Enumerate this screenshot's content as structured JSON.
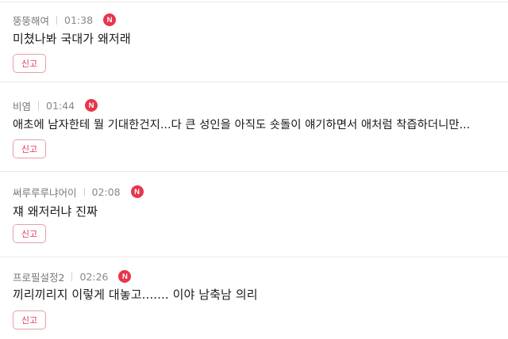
{
  "comments": [
    {
      "author": "뚱뚱해여",
      "time": "01:38",
      "badge": "N",
      "text": "미쳤나봐 국대가 왜저래",
      "report_label": "신고"
    },
    {
      "author": "비염",
      "time": "01:44",
      "badge": "N",
      "text": "애초에 남자한테 뭘 기대한건지...다 큰 성인을 아직도 숏돌이 얘기하면서 애처럼 착즙하더니만...",
      "report_label": "신고"
    },
    {
      "author": "써루루루냐어이",
      "time": "02:08",
      "badge": "N",
      "text": "쟤 왜저러냐 진짜",
      "report_label": "신고"
    },
    {
      "author": "프로필설정2",
      "time": "02:26",
      "badge": "N",
      "text": "끼리끼리지 이렇게 대놓고....... 이야 남축남 의리",
      "report_label": "신고"
    }
  ],
  "colors": {
    "accent": "#e8364c",
    "report_border": "#e6a0a6",
    "divider": "#e9e9e9"
  }
}
